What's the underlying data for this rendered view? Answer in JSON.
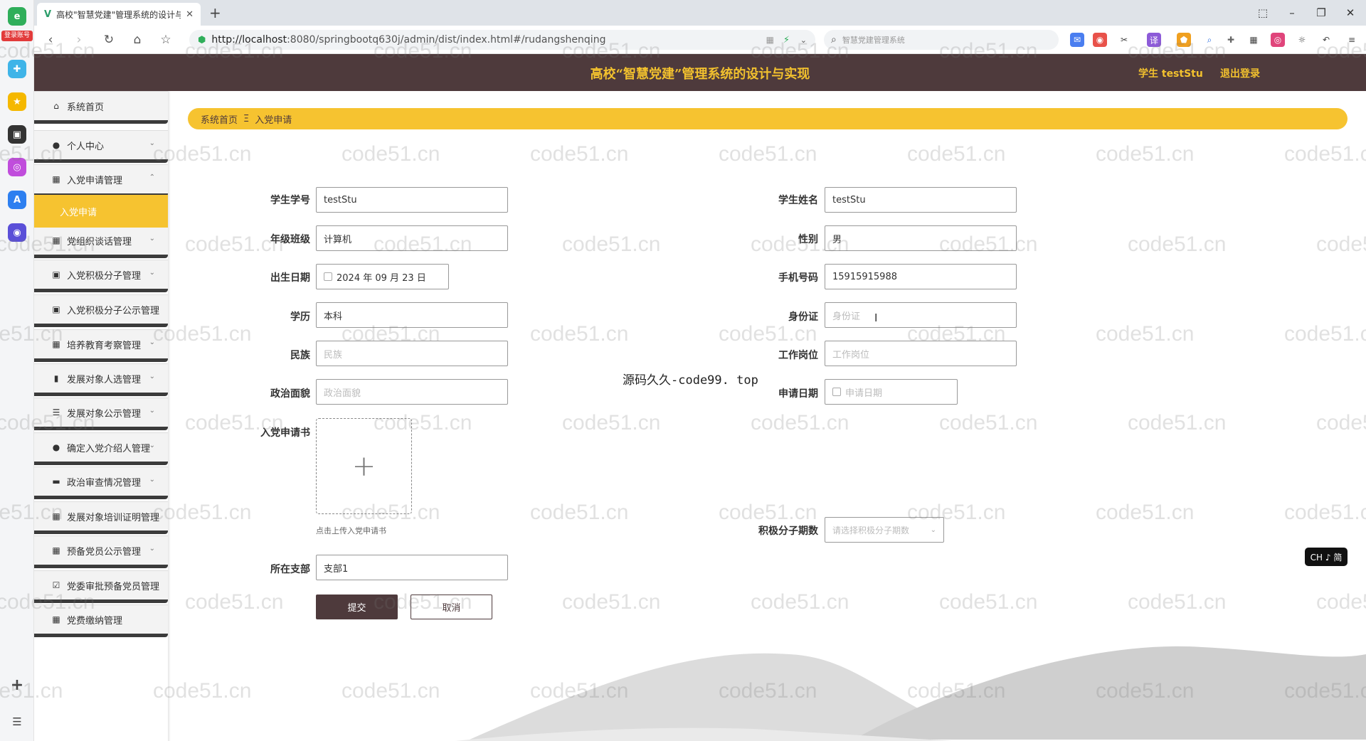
{
  "browser": {
    "tab_title": "高校\"智慧党建\"管理系统的设计与",
    "url_host": "http://localhost",
    "url_rest": ":8080/springbootq630j/admin/dist/index.html#/rudangshenqing",
    "search_placeholder": "智慧党建管理系统",
    "rail_badge": "登录账号"
  },
  "header": {
    "title": "高校“智慧党建”管理系统的设计与实现",
    "user": "学生 testStu",
    "logout": "退出登录"
  },
  "sidebar": {
    "items": [
      {
        "label": "系统首页",
        "icon": "home-icon",
        "chevron": false
      },
      {
        "label": "个人中心",
        "icon": "user-icon",
        "chevron": true
      },
      {
        "label": "入党申请管理",
        "icon": "grid-icon",
        "chevron": true
      },
      {
        "label": "党组织谈话管理",
        "icon": "grid-icon",
        "chevron": true
      },
      {
        "label": "入党积极分子管理",
        "icon": "clipboard-icon",
        "chevron": true
      },
      {
        "label": "入党积极分子公示管理",
        "icon": "clipboard-icon",
        "chevron": false
      },
      {
        "label": "培养教育考察管理",
        "icon": "grid-icon",
        "chevron": true
      },
      {
        "label": "发展对象人选管理",
        "icon": "chart-icon",
        "chevron": true
      },
      {
        "label": "发展对象公示管理",
        "icon": "sliders-icon",
        "chevron": true
      },
      {
        "label": "确定入党介绍人管理",
        "icon": "user-icon",
        "chevron": true
      },
      {
        "label": "政治审查情况管理",
        "icon": "monitor-icon",
        "chevron": true
      },
      {
        "label": "发展对象培训证明管理",
        "icon": "grid-icon",
        "chevron": false
      },
      {
        "label": "预备党员公示管理",
        "icon": "grid-icon",
        "chevron": true
      },
      {
        "label": "党委审批预备党员管理",
        "icon": "check-icon",
        "chevron": false
      },
      {
        "label": "党费缴纳管理",
        "icon": "grid-icon",
        "chevron": false
      }
    ],
    "active_sub": "入党申请"
  },
  "breadcrumb": {
    "home": "系统首页",
    "sep": "Ξ",
    "current": "入党申请"
  },
  "form": {
    "student_no_label": "学生学号",
    "student_no": "testStu",
    "student_name_label": "学生姓名",
    "student_name": "testStu",
    "class_label": "年级班级",
    "class": "计算机",
    "gender_label": "性别",
    "gender": "男",
    "birth_label": "出生日期",
    "birth": "2024 年 09 月 23 日",
    "phone_label": "手机号码",
    "phone": "15915915988",
    "edu_label": "学历",
    "edu": "本科",
    "idcard_label": "身份证",
    "idcard_ph": "身份证",
    "nation_label": "民族",
    "nation_ph": "民族",
    "job_label": "工作岗位",
    "job_ph": "工作岗位",
    "political_label": "政治面貌",
    "political_ph": "政治面貌",
    "apply_date_label": "申请日期",
    "apply_date_ph": "申请日期",
    "letter_label": "入党申请书",
    "upload_plus": "+",
    "upload_hint": "点击上传入党申请书",
    "period_label": "积极分子期数",
    "period_ph": "请选择积极分子期数",
    "branch_label": "所在支部",
    "branch": "支部1",
    "submit": "提交",
    "cancel": "取消"
  },
  "center_note": "源码久久-code99. top",
  "ime_badge": "CH ♪ 简",
  "watermark": "code51.cn",
  "colors": {
    "header_bg": "#4e3a3c",
    "accent": "#f6c330",
    "title_gold": "#f2c12e"
  }
}
